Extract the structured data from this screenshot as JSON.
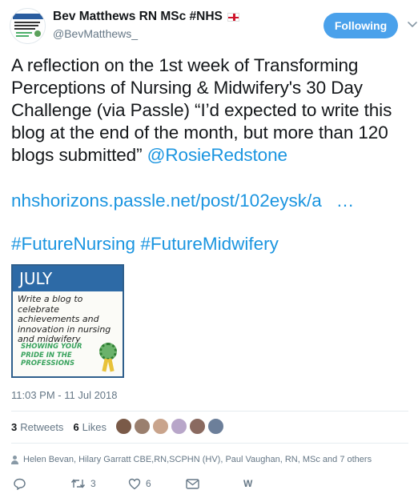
{
  "user": {
    "display_name": "Bev Matthews RN MSc #NHS",
    "handle": "@BevMatthews_",
    "follow_label": "Following"
  },
  "tweet": {
    "text_before_mention": "A reflection on the 1st week of Transforming Perceptions of Nursing & Midwifery's 30 Day Challenge (via Passle) “I’d expected to write this blog at the end of the month, but more than 120 blogs submitted”",
    "mention": "@RosieRedstone",
    "link": "nhshorizons.passle.net/post/102eysk/a",
    "link_ellipsis": "…",
    "hashtags": "#FutureNursing #FutureMidwifery",
    "media": {
      "banner": "JULY",
      "blurb": "Write a blog to celebrate achievements and innovation in nursing and midwifery",
      "pride": "SHOWING YOUR PRIDE IN THE PROFESSIONS"
    },
    "timestamp": "11:03 PM - 11 Jul 2018"
  },
  "stats": {
    "retweets_count": "3",
    "retweets_label": "Retweets",
    "likes_count": "6",
    "likes_label": "Likes",
    "liker_avatar_colors": [
      "#7a5a48",
      "#9a7f6e",
      "#c9a48c",
      "#b8a6c9",
      "#8a6a60",
      "#6c7f9a"
    ]
  },
  "likers_text": "Helen Bevan, Hilary Garratt CBE,RN,SCPHN (HV), Paul Vaughan, RN, MSc and 7 others",
  "actions": {
    "reply_icon": "reply-icon",
    "retweet_count": "3",
    "like_count": "6",
    "dm_icon": "envelope-icon",
    "w_label": "W"
  },
  "colors": {
    "accent": "#1b95e0",
    "follow_button": "#4aa1eb",
    "muted": "#657786"
  }
}
